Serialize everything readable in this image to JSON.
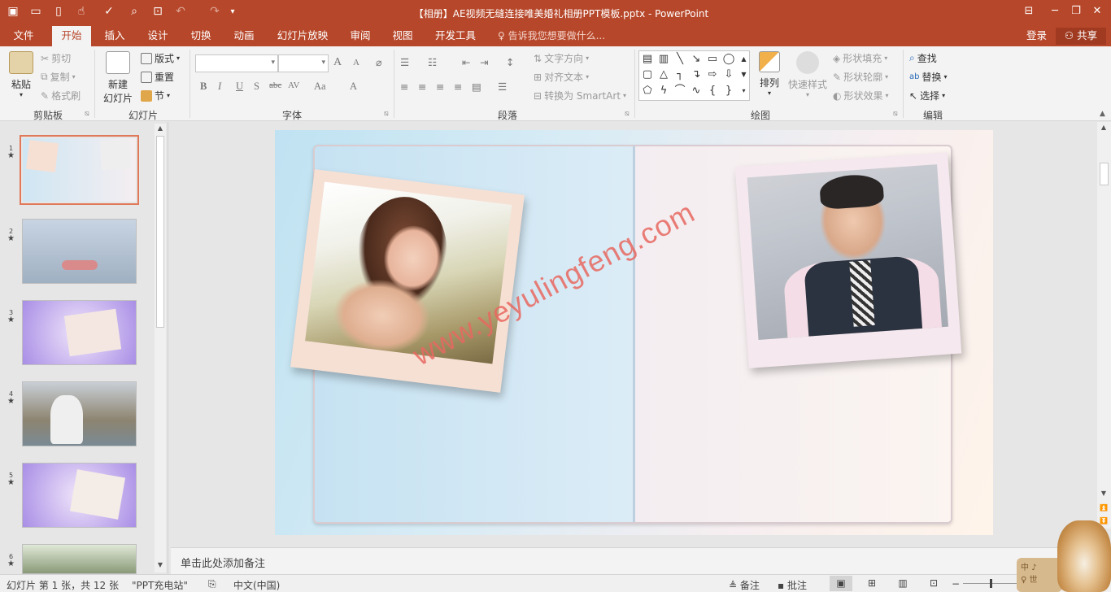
{
  "window": {
    "title": "【相册】AE视频无缝连接唯美婚礼相册PPT模板.pptx - PowerPoint",
    "quick_access_icons": [
      "save-icon",
      "open-folder-icon",
      "new-file-icon",
      "touch-mode-icon",
      "spelling-icon",
      "find-icon",
      "slideshow-from-start-icon",
      "undo-icon",
      "redo-icon",
      "customize-quick-access-icon"
    ],
    "controls": [
      "ribbon-display-icon",
      "minimize-icon",
      "restore-icon",
      "close-icon"
    ]
  },
  "tabs": [
    {
      "label": "文件",
      "active": false
    },
    {
      "label": "开始",
      "active": true
    },
    {
      "label": "插入",
      "active": false
    },
    {
      "label": "设计",
      "active": false
    },
    {
      "label": "切换",
      "active": false
    },
    {
      "label": "动画",
      "active": false
    },
    {
      "label": "幻灯片放映",
      "active": false
    },
    {
      "label": "审阅",
      "active": false
    },
    {
      "label": "视图",
      "active": false
    },
    {
      "label": "开发工具",
      "active": false
    }
  ],
  "tell_me": "告诉我您想要做什么...",
  "account": {
    "login": "登录",
    "share": "共享"
  },
  "ribbon": {
    "clipboard": {
      "label": "剪贴板",
      "paste": "粘贴",
      "cut": "剪切",
      "copy": "复制",
      "format_painter": "格式刷"
    },
    "slides": {
      "label": "幻灯片",
      "new_slide_line1": "新建",
      "new_slide_line2": "幻灯片",
      "layout": "版式",
      "reset": "重置",
      "section": "节"
    },
    "font": {
      "label": "字体",
      "font_name": "",
      "font_size": "",
      "bold": "B",
      "italic": "I",
      "underline": "U",
      "shadow": "S",
      "strike": "abc",
      "spacing": "AV",
      "case": "Aa",
      "color": "A",
      "grow": "A",
      "shrink": "A"
    },
    "paragraph": {
      "label": "段落",
      "text_direction": "文字方向",
      "align_text": "对齐文本",
      "smartart": "转换为 SmartArt"
    },
    "drawing": {
      "label": "绘图",
      "arrange": "排列",
      "quick_styles": "快速样式",
      "shape_fill": "形状填充",
      "shape_outline": "形状轮廓",
      "shape_effects": "形状效果"
    },
    "editing": {
      "label": "编辑",
      "find": "查找",
      "replace": "替换",
      "select": "选择"
    }
  },
  "thumbnails": [
    {
      "num": "1",
      "selected": true
    },
    {
      "num": "2",
      "selected": false
    },
    {
      "num": "3",
      "selected": false
    },
    {
      "num": "4",
      "selected": false
    },
    {
      "num": "5",
      "selected": false
    },
    {
      "num": "6",
      "selected": false
    }
  ],
  "slide": {
    "watermark": "www.yeyulingfeng.com"
  },
  "notes_placeholder": "单击此处添加备注",
  "status": {
    "slide_info": "幻灯片 第 1 张，共 12 张",
    "theme": "\"PPT充电站\"",
    "language": "中文(中国)",
    "notes": "备注",
    "comments": "批注"
  },
  "mascot": {
    "plate_line1": "中 ♪",
    "plate_line2": "♀ 世"
  },
  "colors": {
    "accent": "#b7472a",
    "selection": "#e0795a",
    "watermark": "#e86860"
  }
}
